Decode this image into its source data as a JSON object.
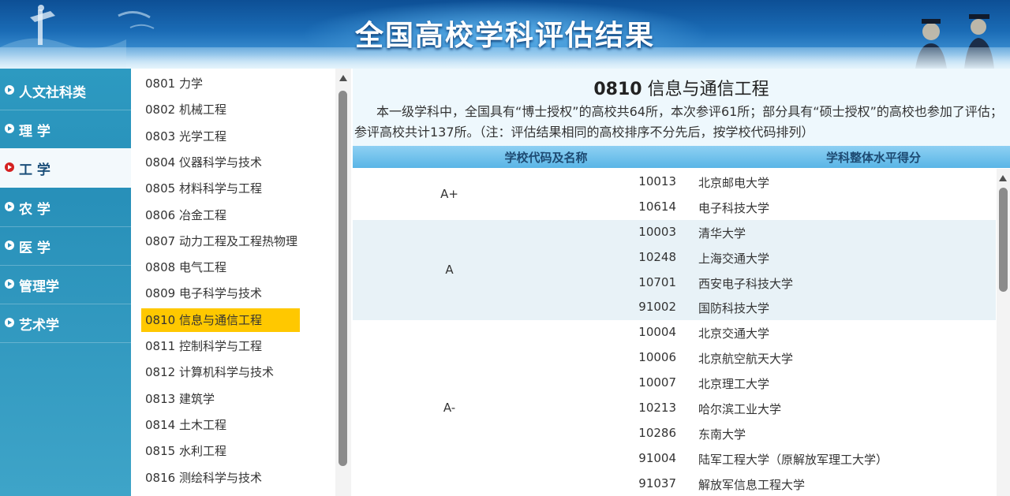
{
  "header": {
    "title": "全国高校学科评估结果"
  },
  "categories": [
    {
      "label": "人文社科类",
      "active": false
    },
    {
      "label": "理 学",
      "active": false
    },
    {
      "label": "工 学",
      "active": true
    },
    {
      "label": "农 学",
      "active": false
    },
    {
      "label": "医 学",
      "active": false
    },
    {
      "label": "管理学",
      "active": false
    },
    {
      "label": "艺术学",
      "active": false
    }
  ],
  "subjects": [
    {
      "label": "0801 力学"
    },
    {
      "label": "0802 机械工程"
    },
    {
      "label": "0803 光学工程"
    },
    {
      "label": "0804 仪器科学与技术"
    },
    {
      "label": "0805 材料科学与工程"
    },
    {
      "label": "0806 冶金工程"
    },
    {
      "label": "0807 动力工程及工程热物理"
    },
    {
      "label": "0808 电气工程"
    },
    {
      "label": "0809 电子科学与技术"
    },
    {
      "label": "0810 信息与通信工程",
      "active": true
    },
    {
      "label": "0811 控制科学与工程"
    },
    {
      "label": "0812 计算机科学与技术"
    },
    {
      "label": "0813 建筑学"
    },
    {
      "label": "0814 土木工程"
    },
    {
      "label": "0815 水利工程"
    },
    {
      "label": "0816 测绘科学与技术"
    }
  ],
  "main": {
    "title_code": "0810",
    "title_name": " 信息与通信工程",
    "intro": "本一级学科中，全国具有“博士授权”的高校共64所，本次参评61所；部分具有“硕士授权”的高校也参加了评估；参评高校共计137所。（注：评估结果相同的高校排序不分先后，按学校代码排列）",
    "col_school": "学校代码及名称",
    "col_score": "学科整体水平得分"
  },
  "results": [
    {
      "grade": "A+",
      "schools": [
        {
          "code": "10013",
          "name": "北京邮电大学"
        },
        {
          "code": "10614",
          "name": "电子科技大学"
        }
      ]
    },
    {
      "grade": "A",
      "schools": [
        {
          "code": "10003",
          "name": "清华大学"
        },
        {
          "code": "10248",
          "name": "上海交通大学"
        },
        {
          "code": "10701",
          "name": "西安电子科技大学"
        },
        {
          "code": "91002",
          "name": "国防科技大学"
        }
      ]
    },
    {
      "grade": "A-",
      "schools": [
        {
          "code": "10004",
          "name": "北京交通大学"
        },
        {
          "code": "10006",
          "name": "北京航空航天大学"
        },
        {
          "code": "10007",
          "name": "北京理工大学"
        },
        {
          "code": "10213",
          "name": "哈尔滨工业大学"
        },
        {
          "code": "10286",
          "name": "东南大学"
        },
        {
          "code": "91004",
          "name": "陆军工程大学（原解放军理工大学）"
        },
        {
          "code": "91037",
          "name": "解放军信息工程大学"
        }
      ]
    }
  ],
  "colors": {
    "accent_selected": "#ffc800",
    "sidebar_blue": "#2d9ac1",
    "table_header": "#59b5e6",
    "row_shade": "#e8f2f7"
  }
}
